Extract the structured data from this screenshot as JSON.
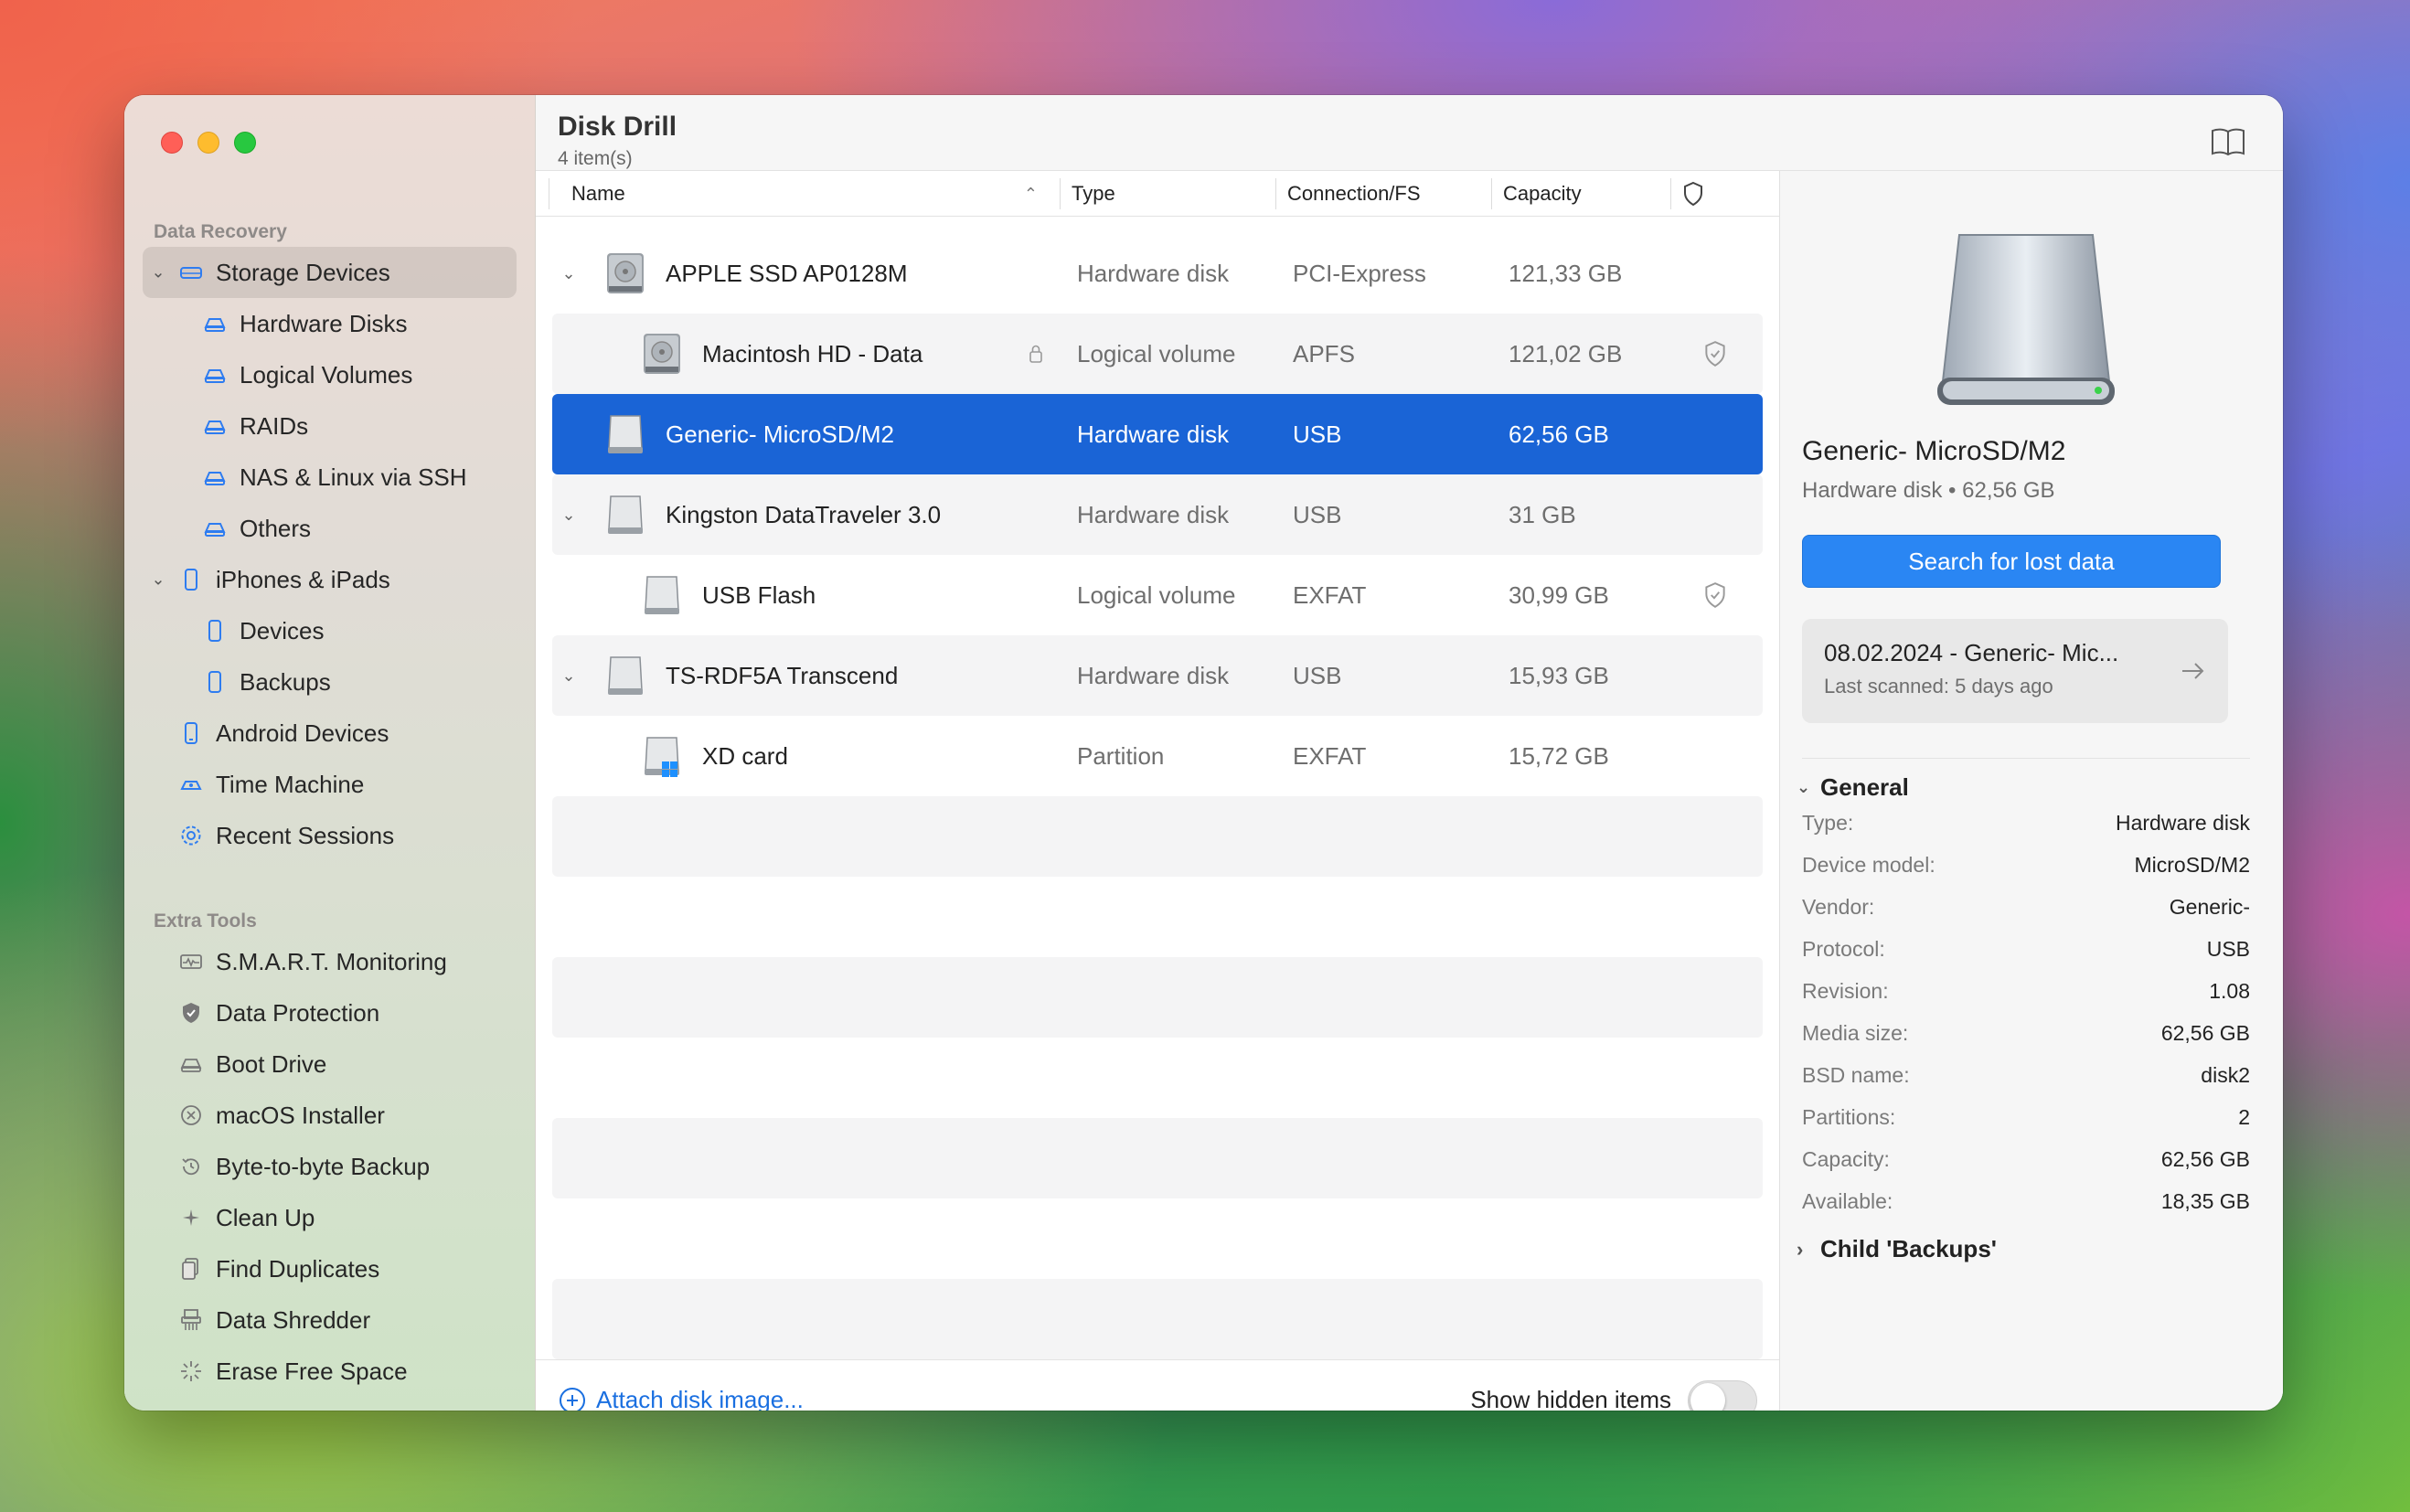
{
  "window": {
    "title": "Disk Drill",
    "item_count": "4 item(s)"
  },
  "sidebar": {
    "section_recovery": "Data Recovery",
    "section_tools": "Extra Tools",
    "recovery_items": [
      {
        "label": "Storage Devices",
        "icon": "storage-icon"
      },
      {
        "label": "Hardware Disks",
        "icon": "disk-icon"
      },
      {
        "label": "Logical Volumes",
        "icon": "disk-icon"
      },
      {
        "label": "RAIDs",
        "icon": "disk-icon"
      },
      {
        "label": "NAS & Linux via SSH",
        "icon": "disk-icon"
      },
      {
        "label": "Others",
        "icon": "disk-icon"
      },
      {
        "label": "iPhones & iPads",
        "icon": "phone-icon"
      },
      {
        "label": "Devices",
        "icon": "phone-icon"
      },
      {
        "label": "Backups",
        "icon": "phone-icon"
      },
      {
        "label": "Android Devices",
        "icon": "android-icon"
      },
      {
        "label": "Time Machine",
        "icon": "time-machine-icon"
      },
      {
        "label": "Recent Sessions",
        "icon": "gear-icon"
      }
    ],
    "tool_items": [
      {
        "label": "S.M.A.R.T. Monitoring",
        "icon": "smart-icon"
      },
      {
        "label": "Data Protection",
        "icon": "shield-icon"
      },
      {
        "label": "Boot Drive",
        "icon": "drive-icon"
      },
      {
        "label": "macOS Installer",
        "icon": "x-circle-icon"
      },
      {
        "label": "Byte-to-byte Backup",
        "icon": "history-icon"
      },
      {
        "label": "Clean Up",
        "icon": "sparkle-icon"
      },
      {
        "label": "Find Duplicates",
        "icon": "documents-icon"
      },
      {
        "label": "Data Shredder",
        "icon": "shredder-icon"
      },
      {
        "label": "Erase Free Space",
        "icon": "erase-icon"
      }
    ]
  },
  "columns": {
    "name": "Name",
    "type": "Type",
    "connection": "Connection/FS",
    "capacity": "Capacity"
  },
  "devices": [
    {
      "name": "APPLE SSD AP0128M",
      "type": "Hardware disk",
      "connection": "PCI-Express",
      "capacity": "121,33 GB"
    },
    {
      "name": "Macintosh HD - Data",
      "type": "Logical volume",
      "connection": "APFS",
      "capacity": "121,02 GB"
    },
    {
      "name": "Generic- MicroSD/M2",
      "type": "Hardware disk",
      "connection": "USB",
      "capacity": "62,56 GB"
    },
    {
      "name": "Kingston DataTraveler 3.0",
      "type": "Hardware disk",
      "connection": "USB",
      "capacity": "31 GB"
    },
    {
      "name": "USB Flash",
      "type": "Logical volume",
      "connection": "EXFAT",
      "capacity": "30,99 GB"
    },
    {
      "name": "TS-RDF5A Transcend",
      "type": "Hardware disk",
      "connection": "USB",
      "capacity": "15,93 GB"
    },
    {
      "name": "XD card",
      "type": "Partition",
      "connection": "EXFAT",
      "capacity": "15,72 GB"
    }
  ],
  "bottom": {
    "attach_label": "Attach disk image...",
    "hidden_label": "Show hidden items",
    "hidden_on": false
  },
  "details": {
    "name": "Generic- MicroSD/M2",
    "subtitle": "Hardware disk • 62,56 GB",
    "search_button": "Search for lost data",
    "session_title": "08.02.2024 - Generic- Mic...",
    "session_sub": "Last scanned: 5 days ago",
    "general_label": "General",
    "child_label": "Child 'Backups'",
    "props": [
      {
        "k": "Type:",
        "v": "Hardware disk"
      },
      {
        "k": "Device model:",
        "v": "MicroSD/M2"
      },
      {
        "k": "Vendor:",
        "v": "Generic-"
      },
      {
        "k": "Protocol:",
        "v": "USB"
      },
      {
        "k": "Revision:",
        "v": "1.08"
      },
      {
        "k": "Media size:",
        "v": "62,56 GB"
      },
      {
        "k": "BSD name:",
        "v": "disk2"
      },
      {
        "k": "Partitions:",
        "v": "2"
      },
      {
        "k": "Capacity:",
        "v": "62,56 GB"
      },
      {
        "k": "Available:",
        "v": "18,35 GB"
      }
    ]
  },
  "colors": {
    "accent": "#1a64d6",
    "link": "#1a6fe0",
    "sidebar_icon": "#2e7cf0"
  }
}
